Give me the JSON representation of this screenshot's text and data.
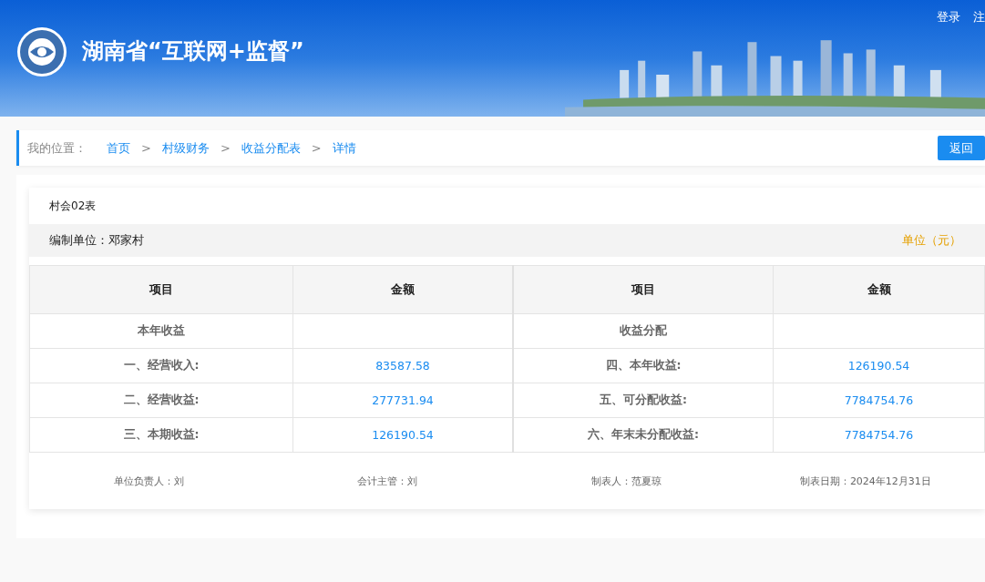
{
  "header": {
    "title": "湖南省“互联网+监督”",
    "links": [
      "登录",
      "注"
    ]
  },
  "breadcrumb": {
    "label": "我的位置：",
    "items": [
      "首页",
      "村级财务",
      "收益分配表",
      "详情"
    ],
    "separator": ">",
    "back_button": "返回"
  },
  "report": {
    "form_code": "村会02表",
    "unit_label": "编制单位：邓家村",
    "currency": "单位（元）",
    "columns": [
      "项目",
      "金额",
      "项目",
      "金额"
    ],
    "rows": [
      {
        "cells": [
          "本年收益",
          "",
          "收益分配",
          ""
        ]
      },
      {
        "cells": [
          "一、经营收入:",
          "83587.58",
          "四、本年收益:",
          "126190.54"
        ]
      },
      {
        "cells": [
          "二、经营收益:",
          "277731.94",
          "五、可分配收益:",
          "7784754.76"
        ]
      },
      {
        "cells": [
          "三、本期收益:",
          "126190.54",
          "六、年末未分配收益:",
          "7784754.76"
        ]
      }
    ],
    "signatures": [
      "单位负责人：刘",
      "会计主管：刘",
      "制表人：范夏琼",
      "制表日期：2024年12月31日"
    ]
  }
}
